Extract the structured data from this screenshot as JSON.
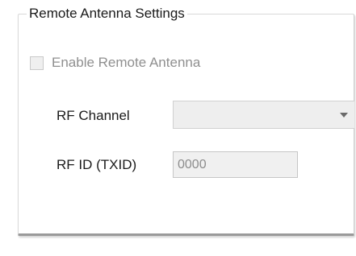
{
  "group": {
    "title": "Remote Antenna Settings"
  },
  "enable_remote_antenna": {
    "label": "Enable Remote Antenna",
    "checked": false,
    "enabled": false
  },
  "rf_channel": {
    "label": "RF Channel",
    "selected": ""
  },
  "rf_id": {
    "label": "RF ID (TXID)",
    "value": "0000"
  },
  "icons": {
    "dropdown": "chevron-down-icon"
  }
}
